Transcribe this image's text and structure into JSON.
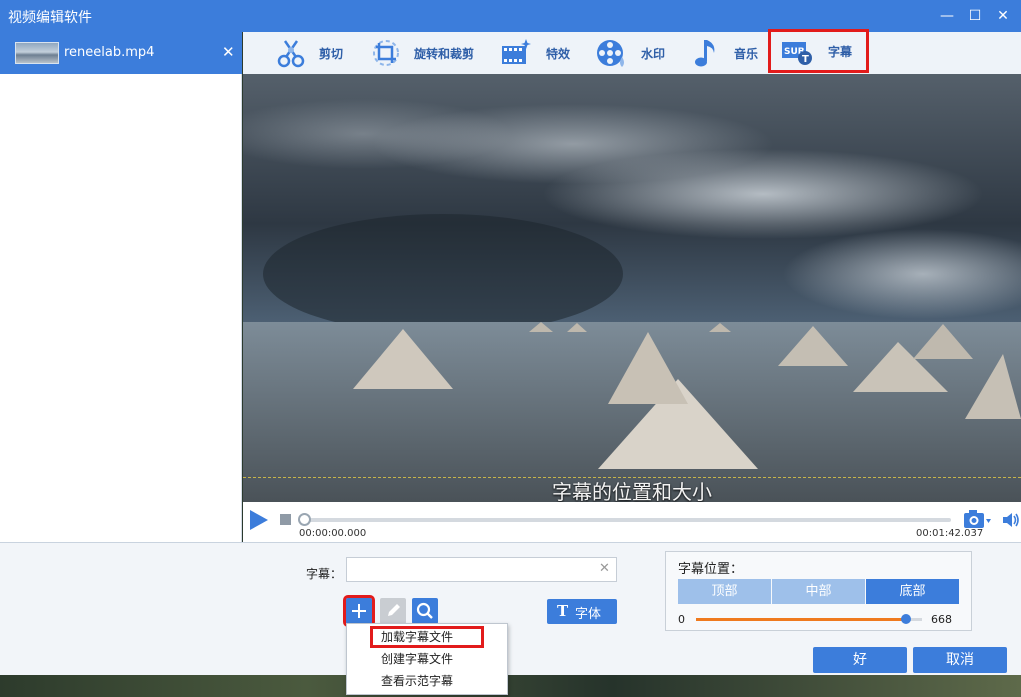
{
  "window": {
    "title": "视频编辑软件"
  },
  "file": {
    "name": "reneelab.mp4"
  },
  "toolbar": {
    "items": [
      {
        "label": "剪切",
        "icon": "scissors-icon"
      },
      {
        "label": "旋转和裁剪",
        "icon": "crop-rotate-icon"
      },
      {
        "label": "特效",
        "icon": "film-sparkle-icon"
      },
      {
        "label": "水印",
        "icon": "reel-watermark-icon"
      },
      {
        "label": "音乐",
        "icon": "music-note-icon"
      },
      {
        "label": "字幕",
        "icon": "subtitle-sub-icon"
      }
    ],
    "active": "字幕",
    "sub_badge": "SUB"
  },
  "video": {
    "subtitle_preview": "字幕的位置和大小"
  },
  "player": {
    "current_time": "00:00:00.000",
    "total_time": "00:01:42.037",
    "progress": 0.0
  },
  "subtitle": {
    "label": "字幕：",
    "value": "",
    "font_button": "字体",
    "font_glyph": "T"
  },
  "position": {
    "title": "字幕位置：",
    "options": [
      "顶部",
      "中部",
      "底部"
    ],
    "selected": "底部",
    "min": "0",
    "value": "668",
    "fraction": 0.93
  },
  "menu": {
    "items": [
      "加载字幕文件",
      "创建字幕文件",
      "查看示范字幕"
    ]
  },
  "actions": {
    "ok": "好",
    "cancel": "取消"
  },
  "colors": {
    "accent": "#3c7ddb",
    "highlight": "#e21b1b",
    "slider_fill": "#ef7a1e"
  }
}
